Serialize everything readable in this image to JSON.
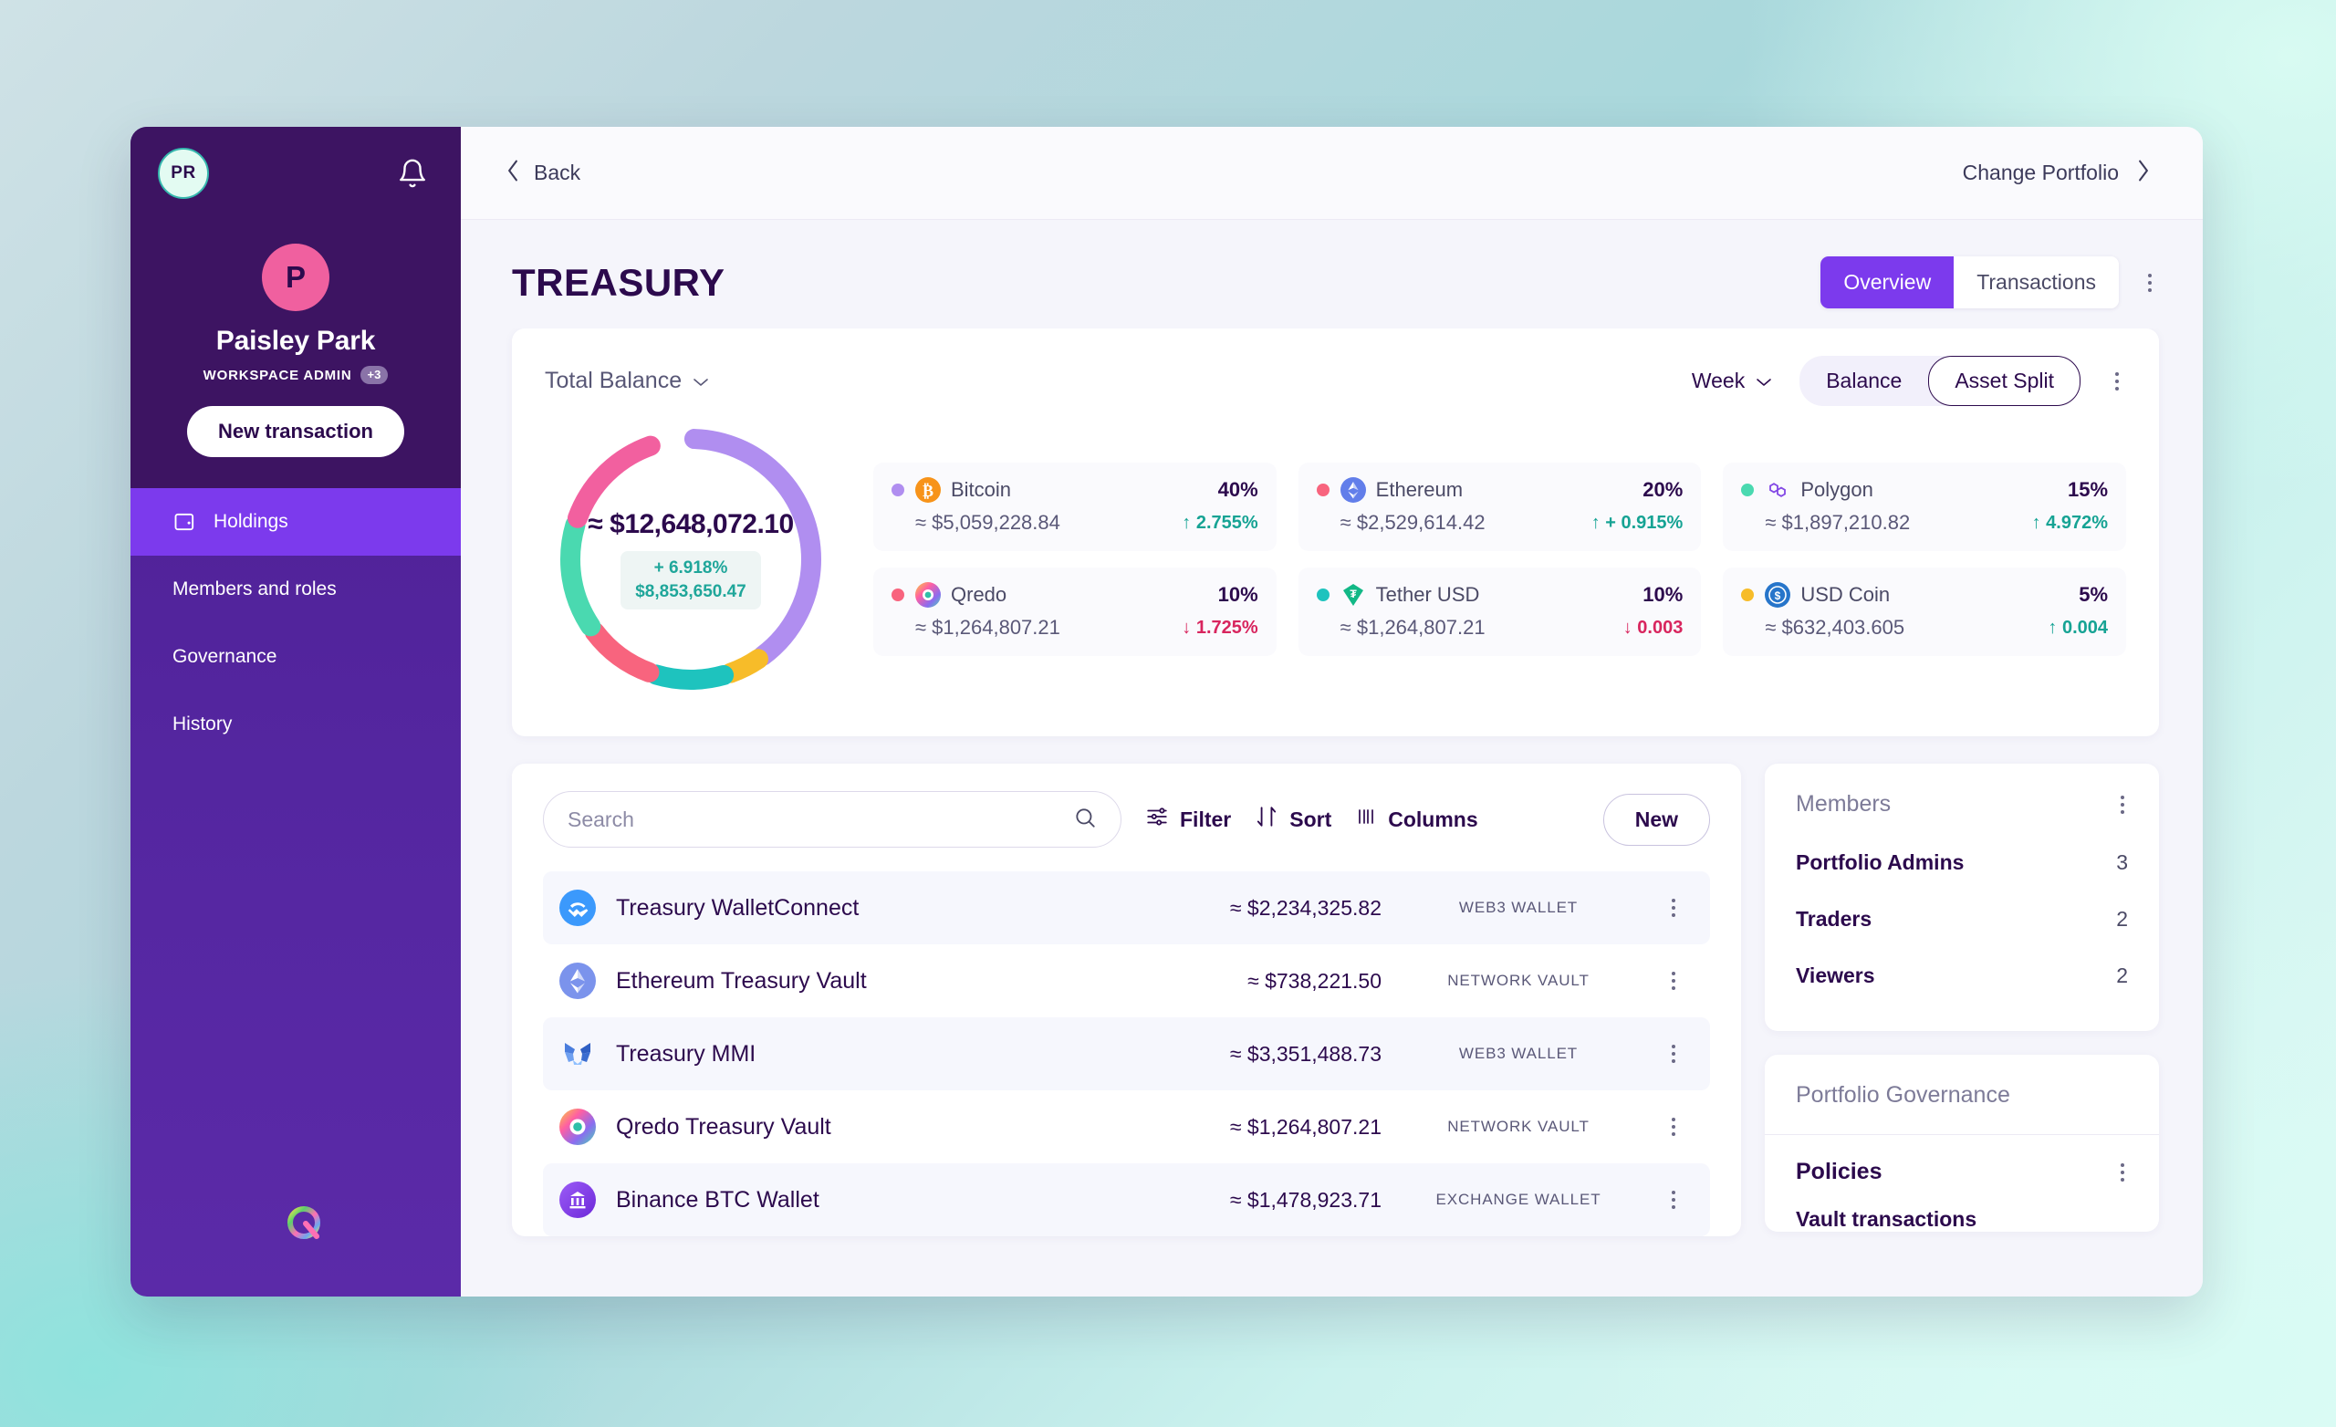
{
  "sidebar": {
    "org_badge": "PR",
    "bell_icon": "bell-icon",
    "avatar_letter": "P",
    "profile_name": "Paisley Park",
    "profile_role": "WORKSPACE ADMIN",
    "role_more": "+3",
    "new_transaction_label": "New transaction",
    "items": [
      {
        "label": "Holdings",
        "icon": "wallet-icon",
        "active": true
      },
      {
        "label": "Members and roles",
        "icon": "",
        "active": false
      },
      {
        "label": "Governance",
        "icon": "",
        "active": false
      },
      {
        "label": "History",
        "icon": "",
        "active": false
      }
    ],
    "logo_name": "qredo-logo"
  },
  "topbar": {
    "back_label": "Back",
    "back_icon": "chevron-left-icon",
    "change_portfolio_label": "Change Portfolio",
    "change_portfolio_icon": "chevron-right-icon"
  },
  "page": {
    "title": "TREASURY",
    "tabs": [
      {
        "label": "Overview",
        "active": true
      },
      {
        "label": "Transactions",
        "active": false
      }
    ],
    "kebab_icon": "more-vertical-icon"
  },
  "balance_card": {
    "total_balance_label": "Total Balance",
    "total_balance_caret": "chevron-down-icon",
    "period_label": "Week",
    "period_caret": "chevron-down-icon",
    "view_modes": [
      {
        "label": "Balance",
        "active": false
      },
      {
        "label": "Asset Split",
        "active": true
      }
    ],
    "kebab_icon": "more-vertical-icon",
    "center_total": "≈ $12,648,072.10",
    "center_delta_pct": "+ 6.918%",
    "center_delta_amount": "$8,853,650.47"
  },
  "chart_data": {
    "type": "pie",
    "title": "Total Balance — Asset Split",
    "legend_position": "right",
    "categories": [
      "Bitcoin",
      "Ethereum",
      "Polygon",
      "Qredo",
      "Tether USD",
      "USD Coin"
    ],
    "values": [
      40,
      20,
      15,
      10,
      10,
      5
    ],
    "unit": "%",
    "total_label": "≈ $12,648,072.10",
    "total_value": 12648072.1,
    "delta_pct": 6.918,
    "delta_amount": 8853650.47,
    "slice_colors": [
      "#b08ef0",
      "#f8647e",
      "#4ad9b0",
      "#f2609f",
      "#1ec3be",
      "#f7bc29"
    ],
    "assets": [
      {
        "name": "Bitcoin",
        "dot": "#b08ef0",
        "pct": "40%",
        "amount": "≈ $5,059,228.84",
        "change": "2.755%",
        "dir": "up",
        "arrow": "↑",
        "icon": "bitcoin-icon",
        "value": 5059228.84
      },
      {
        "name": "Ethereum",
        "dot": "#f8647e",
        "pct": "20%",
        "amount": "≈ $2,529,614.42",
        "change": "+ 0.915%",
        "dir": "up",
        "arrow": "↑",
        "icon": "ethereum-icon",
        "value": 2529614.42
      },
      {
        "name": "Polygon",
        "dot": "#4ad9b0",
        "pct": "15%",
        "amount": "≈ $1,897,210.82",
        "change": "4.972%",
        "dir": "up",
        "arrow": "↑",
        "icon": "polygon-icon",
        "value": 1897210.82
      },
      {
        "name": "Qredo",
        "dot": "#f8647e",
        "pct": "10%",
        "amount": "≈ $1,264,807.21",
        "change": "1.725%",
        "dir": "down",
        "arrow": "↓",
        "icon": "qredo-icon",
        "value": 1264807.21
      },
      {
        "name": "Tether USD",
        "dot": "#1ec3be",
        "pct": "10%",
        "amount": "≈ $1,264,807.21",
        "change": "0.003",
        "dir": "down",
        "arrow": "↓",
        "icon": "tether-icon",
        "value": 1264807.21
      },
      {
        "name": "USD Coin",
        "dot": "#f7bc29",
        "pct": "5%",
        "amount": "≈ $632,403.605",
        "change": "0.004",
        "dir": "up",
        "arrow": "↑",
        "icon": "usdcoin-icon",
        "value": 632403.605
      }
    ]
  },
  "wallets": {
    "search_placeholder": "Search",
    "search_value": "",
    "search_icon": "search-icon",
    "filter_label": "Filter",
    "filter_icon": "sliders-icon",
    "sort_label": "Sort",
    "sort_icon": "sort-arrows-icon",
    "columns_label": "Columns",
    "columns_icon": "columns-icon",
    "new_label": "New",
    "rows": [
      {
        "name": "Treasury WalletConnect",
        "amount": "≈ $2,234,325.82",
        "type": "WEB3 WALLET",
        "icon": "walletconnect-icon"
      },
      {
        "name": "Ethereum Treasury Vault",
        "amount": "≈ $738,221.50",
        "type": "NETWORK VAULT",
        "icon": "ethereum-icon"
      },
      {
        "name": "Treasury MMI",
        "amount": "≈ $3,351,488.73",
        "type": "WEB3 WALLET",
        "icon": "metamask-icon"
      },
      {
        "name": "Qredo Treasury Vault",
        "amount": "≈ $1,264,807.21",
        "type": "NETWORK VAULT",
        "icon": "qredo-icon"
      },
      {
        "name": "Binance BTC Wallet",
        "amount": "≈ $1,478,923.71",
        "type": "EXCHANGE WALLET",
        "icon": "binance-icon"
      }
    ]
  },
  "members_panel": {
    "title": "Members",
    "kebab_icon": "more-vertical-icon",
    "rows": [
      {
        "label": "Portfolio Admins",
        "count": "3"
      },
      {
        "label": "Traders",
        "count": "2"
      },
      {
        "label": "Viewers",
        "count": "2"
      }
    ]
  },
  "governance_panel": {
    "title": "Portfolio Governance",
    "policies_label": "Policies",
    "policies_kebab": "more-vertical-icon",
    "vault_transactions_label": "Vault transactions"
  }
}
